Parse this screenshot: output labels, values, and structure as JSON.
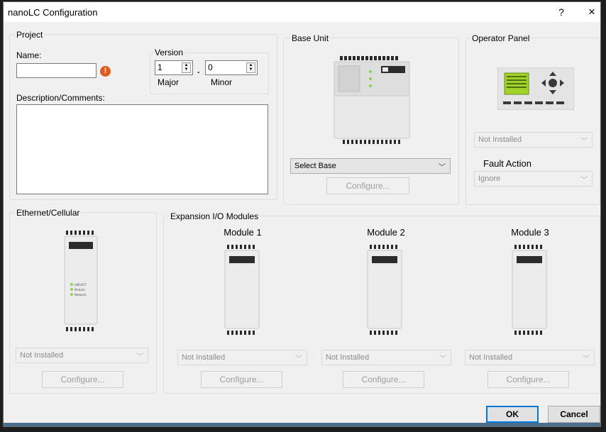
{
  "window": {
    "title": "nanoLC Configuration",
    "help_label": "?",
    "close_label": "×"
  },
  "project": {
    "group_label": "Project",
    "name_label": "Name:",
    "name_value": "",
    "version_label": "Version",
    "version_major": "1",
    "version_sep": ".",
    "version_minor": "0",
    "major_label": "Major",
    "minor_label": "Minor",
    "description_label": "Description/Comments:",
    "description_value": "",
    "error_icon": "!"
  },
  "base_unit": {
    "group_label": "Base Unit",
    "select_value": "Select Base",
    "configure_label": "Configure..."
  },
  "operator_panel": {
    "group_label": "Operator Panel",
    "select_value": "Not Installed",
    "fault_action_label": "Fault Action",
    "fault_action_value": "Ignore"
  },
  "ethernet": {
    "group_label": "Ethernet/Cellular",
    "device_leds": [
      "LNK/ACT",
      "Module",
      "Network"
    ],
    "select_value": "Not Installed",
    "configure_label": "Configure..."
  },
  "expansion": {
    "group_label": "Expansion I/O Modules",
    "modules": [
      {
        "title": "Module 1",
        "select_value": "Not Installed",
        "configure_label": "Configure..."
      },
      {
        "title": "Module 2",
        "select_value": "Not Installed",
        "configure_label": "Configure..."
      },
      {
        "title": "Module 3",
        "select_value": "Not Installed",
        "configure_label": "Configure..."
      }
    ]
  },
  "footer": {
    "ok_label": "OK",
    "cancel_label": "Cancel"
  },
  "colors": {
    "accent": "#0078d7",
    "error": "#e15a1f",
    "led_green": "#8bd34a",
    "lcd_green": "#9fd32a"
  }
}
